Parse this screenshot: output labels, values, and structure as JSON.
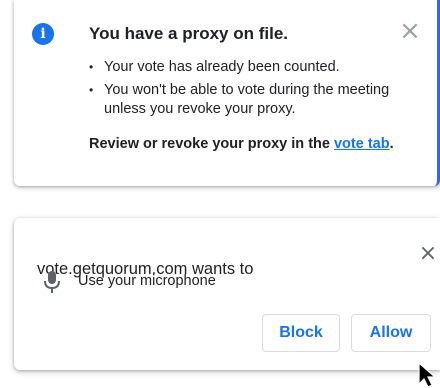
{
  "proxy_notice": {
    "title": "You have a proxy on file.",
    "bullets": [
      "Your vote has already been counted.",
      "You won't be able to vote during the meeting unless you revoke your proxy."
    ],
    "review_text": "Review or revoke your proxy in the ",
    "review_link": "vote tab",
    "review_suffix": ".",
    "icon": "info-icon",
    "close_icon": "close-icon"
  },
  "permission_prompt": {
    "title": "vote.getquorum.com wants to",
    "permission_label": "Use your microphone",
    "permission_icon": "microphone-icon",
    "block_label": "Block",
    "allow_label": "Allow",
    "close_icon": "close-icon"
  },
  "colors": {
    "accent": "#1a73e8",
    "text": "#202124",
    "muted": "#9aa0a6"
  }
}
